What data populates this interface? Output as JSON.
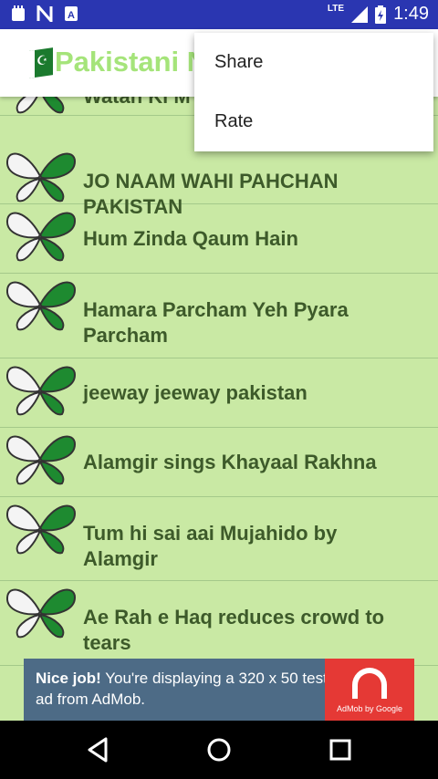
{
  "status_bar": {
    "time": "1:49",
    "network": "LTE",
    "left_icons": [
      "notification-icon",
      "n-icon",
      "a-icon"
    ]
  },
  "toolbar": {
    "title": "Pakistani N"
  },
  "menu": {
    "items": [
      {
        "label": "Share"
      },
      {
        "label": "Rate"
      }
    ]
  },
  "list": {
    "items": [
      {
        "label": "Watan Ki M"
      },
      {
        "label": "JO NAAM WAHI PAHCHAN PAKISTAN"
      },
      {
        "label": "Hum Zinda Qaum Hain"
      },
      {
        "label": "Hamara Parcham Yeh Pyara Parcham"
      },
      {
        "label": "jeeway jeeway pakistan"
      },
      {
        "label": "Alamgir sings Khayaal Rakhna"
      },
      {
        "label": "Tum hi sai aai Mujahido by Alamgir"
      },
      {
        "label": "Ae Rah e Haq reduces crowd to tears"
      }
    ]
  },
  "ad": {
    "bold": "Nice job!",
    "text": " You're displaying a 320 x 50 test ad from AdMob.",
    "brand": "AdMob by Google"
  },
  "colors": {
    "status_bar": "#2a36b1",
    "list_bg": "#c9e9a4",
    "title": "#a5e47a",
    "ad_bg": "#4d6b86",
    "ad_logo": "#e53935"
  }
}
